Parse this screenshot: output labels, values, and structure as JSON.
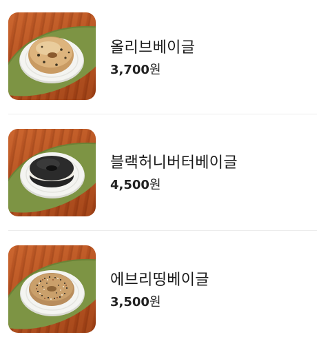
{
  "menu": {
    "items": [
      {
        "name": "올리브베이글",
        "price": "3,700",
        "currency": "원",
        "image_icon": "olive-bagel-photo"
      },
      {
        "name": "블랙허니버터베이글",
        "price": "4,500",
        "currency": "원",
        "image_icon": "black-honey-butter-bagel-photo"
      },
      {
        "name": "에브리띵베이글",
        "price": "3,500",
        "currency": "원",
        "image_icon": "everything-bagel-photo"
      }
    ]
  },
  "colors": {
    "wood": "#b4501f",
    "placemat": "#7d9444",
    "plate": "#f4f4f1",
    "divider": "#ececec"
  }
}
